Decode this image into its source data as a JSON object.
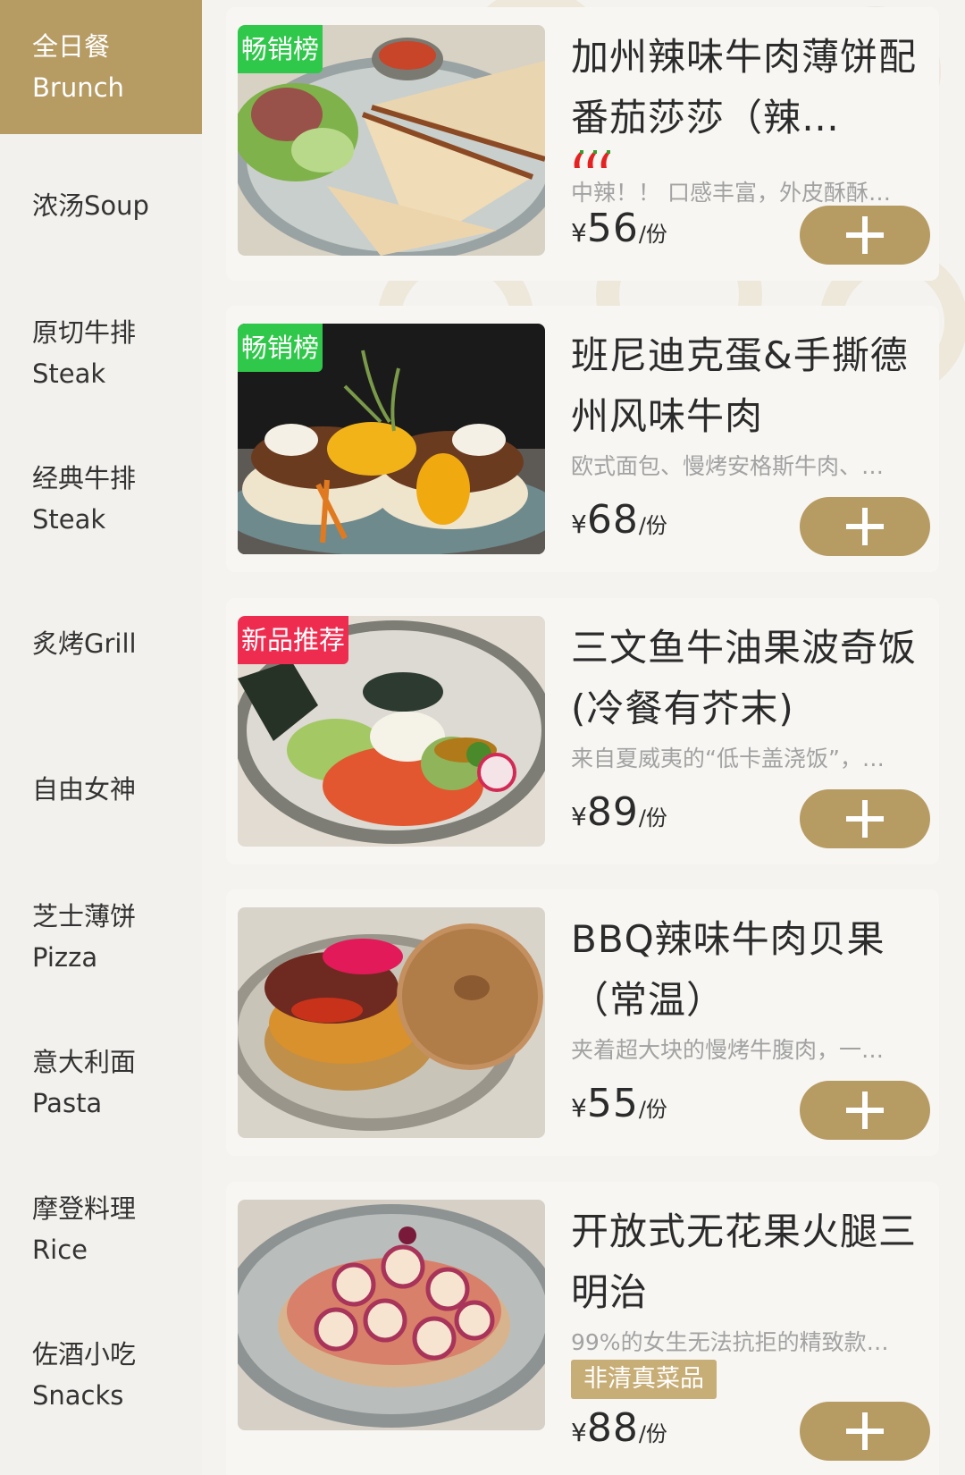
{
  "sidebar": {
    "items": [
      {
        "line1": "全日餐",
        "line2": "Brunch",
        "active": true
      },
      {
        "line1": "浓汤Soup",
        "line2": ""
      },
      {
        "line1": "原切牛排",
        "line2": "Steak"
      },
      {
        "line1": "经典牛排",
        "line2": "Steak"
      },
      {
        "line1": "炙烤Grill",
        "line2": ""
      },
      {
        "line1": "自由女神",
        "line2": ""
      },
      {
        "line1": "芝士薄饼",
        "line2": "Pizza"
      },
      {
        "line1": "意大利面",
        "line2": "Pasta"
      },
      {
        "line1": "摩登料理",
        "line2": "Rice"
      },
      {
        "line1": "佐酒小吃",
        "line2": "Snacks"
      }
    ]
  },
  "products": [
    {
      "tag": "畅销榜",
      "title": "加州辣味牛肉薄饼配番茄莎莎（辣…",
      "desc": "中辣！！ 口感丰富，外皮酥酥…",
      "currency": "¥",
      "price": "56",
      "unit": "/份",
      "spicy_icon": "chili-pepper-icon",
      "image": "quesadilla-plate"
    },
    {
      "tag": "畅销榜",
      "title": "班尼迪克蛋&手撕德州风味牛肉",
      "desc": "欧式面包、慢烤安格斯牛肉、…",
      "currency": "¥",
      "price": "68",
      "unit": "/份",
      "image": "eggs-benedict-plate"
    },
    {
      "tag": "新品推荐",
      "title": "三文鱼牛油果波奇饭(冷餐有芥末)",
      "desc": "来自夏威夷的“低卡盖浇饭”，…",
      "currency": "¥",
      "price": "89",
      "unit": "/份",
      "image": "salmon-poke-bowl"
    },
    {
      "tag": "",
      "title": "BBQ辣味牛肉贝果（常温）",
      "desc": "夹着超大块的慢烤牛腹肉，一…",
      "currency": "¥",
      "price": "55",
      "unit": "/份",
      "image": "beef-bagel-plate"
    },
    {
      "tag": "",
      "title": "开放式无花果火腿三明治",
      "desc": "99%的女生无法抗拒的精致款…",
      "badge": "非清真菜品",
      "currency": "¥",
      "price": "88",
      "unit": "/份",
      "image": "fig-ham-open-sandwich"
    }
  ],
  "colors": {
    "accent": "#b69b63",
    "tag_green": "#2fc84a",
    "tag_red": "#ee2c50"
  },
  "icons": {
    "add": "plus-icon"
  }
}
